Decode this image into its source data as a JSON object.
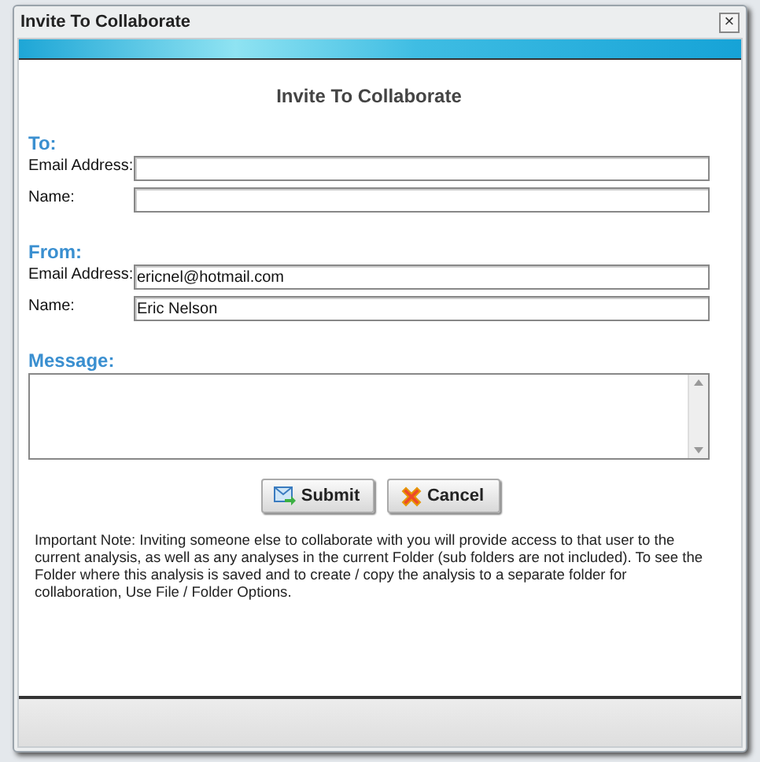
{
  "window": {
    "title": "Invite To Collaborate",
    "close": "×"
  },
  "heading": "Invite To Collaborate",
  "sections": [
    {
      "title": "To:",
      "fields": [
        {
          "label": "Email Address:"
        },
        {
          "label": "Name:"
        }
      ]
    },
    {
      "title": "From:",
      "fields": [
        {
          "label": "Email Address:",
          "value": "ericnel@hotmail.com"
        },
        {
          "label": "Name:",
          "value": "Eric Nelson"
        }
      ]
    }
  ],
  "message": {
    "title": "Message:"
  },
  "buttons": [
    {
      "kind": "submit",
      "label": "Submit"
    },
    {
      "kind": "cancel",
      "label": "Cancel"
    }
  ],
  "note": "Important Note: Inviting someone else to collaborate with you will provide access to that user to the current analysis, as well as any analyses in the current Folder (sub folders are not included). To see the Folder where this analysis is saved and to create / copy the analysis to a separate folder for collaboration, Use File / Folder Options."
}
